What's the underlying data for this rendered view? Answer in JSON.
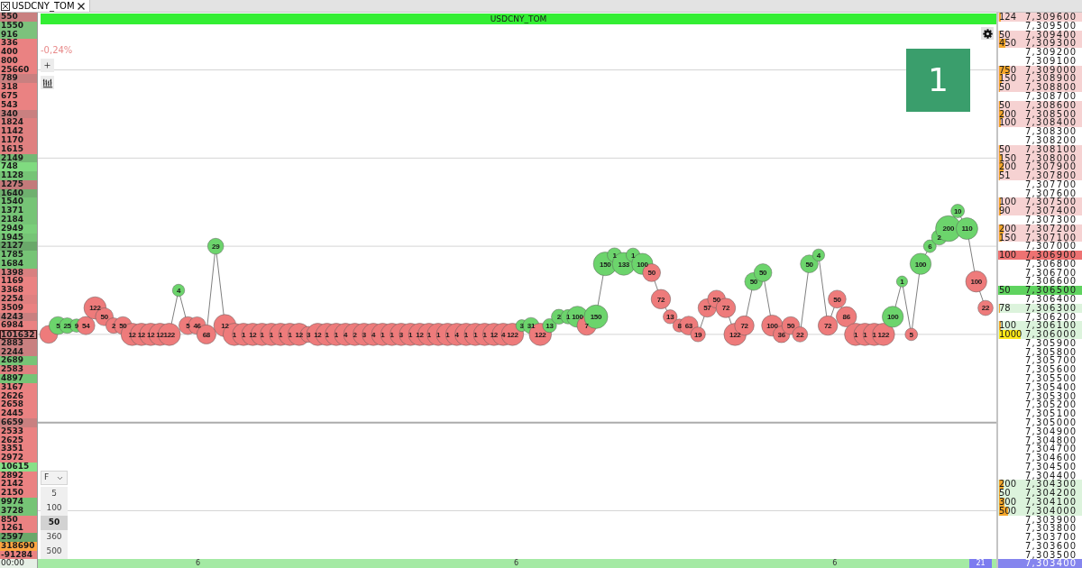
{
  "tab": {
    "title": "USDCNY_TOM"
  },
  "volume_profile": [
    {
      "value": "550",
      "color": "#c98080",
      "highlighted": false
    },
    {
      "value": "1550",
      "color": "#7cc27c",
      "highlighted": false
    },
    {
      "value": "916",
      "color": "#7cc27c",
      "highlighted": false
    },
    {
      "value": "336",
      "color": "#ea8282",
      "highlighted": false
    },
    {
      "value": "400",
      "color": "#ea8282",
      "highlighted": false
    },
    {
      "value": "800",
      "color": "#ea8282",
      "highlighted": false
    },
    {
      "value": "25660",
      "color": "#ea8282",
      "highlighted": false
    },
    {
      "value": "789",
      "color": "#c98080",
      "highlighted": false
    },
    {
      "value": "318",
      "color": "#ea8282",
      "highlighted": false
    },
    {
      "value": "675",
      "color": "#ea8282",
      "highlighted": false
    },
    {
      "value": "543",
      "color": "#ea8282",
      "highlighted": false
    },
    {
      "value": "340",
      "color": "#c98080",
      "highlighted": false
    },
    {
      "value": "1824",
      "color": "#df8080",
      "highlighted": false
    },
    {
      "value": "1142",
      "color": "#df8080",
      "highlighted": false
    },
    {
      "value": "1170",
      "color": "#df8080",
      "highlighted": false
    },
    {
      "value": "1615",
      "color": "#df8080",
      "highlighted": false
    },
    {
      "value": "2149",
      "color": "#74b874",
      "highlighted": false
    },
    {
      "value": "748",
      "color": "#80db80",
      "highlighted": false
    },
    {
      "value": "1128",
      "color": "#76c476",
      "highlighted": false
    },
    {
      "value": "1275",
      "color": "#c37a7a",
      "highlighted": false
    },
    {
      "value": "1640",
      "color": "#6fb06f",
      "highlighted": false
    },
    {
      "value": "1540",
      "color": "#76c476",
      "highlighted": false
    },
    {
      "value": "1371",
      "color": "#76c476",
      "highlighted": false
    },
    {
      "value": "2184",
      "color": "#76c476",
      "highlighted": false
    },
    {
      "value": "2949",
      "color": "#7acf7a",
      "highlighted": false
    },
    {
      "value": "1945",
      "color": "#76c476",
      "highlighted": false
    },
    {
      "value": "2127",
      "color": "#6aa86a",
      "highlighted": false
    },
    {
      "value": "1785",
      "color": "#76c476",
      "highlighted": false
    },
    {
      "value": "1684",
      "color": "#76c476",
      "highlighted": false
    },
    {
      "value": "1398",
      "color": "#d88080",
      "highlighted": false
    },
    {
      "value": "1169",
      "color": "#ea8282",
      "highlighted": false
    },
    {
      "value": "3368",
      "color": "#ea8282",
      "highlighted": false
    },
    {
      "value": "2254",
      "color": "#df8080",
      "highlighted": false
    },
    {
      "value": "3509",
      "color": "#ea8282",
      "highlighted": false
    },
    {
      "value": "4243",
      "color": "#c98080",
      "highlighted": false
    },
    {
      "value": "6984",
      "color": "#ea8282",
      "highlighted": false
    },
    {
      "value": "101632",
      "color": "#d08080",
      "highlighted": true
    },
    {
      "value": "2883",
      "color": "#c98080",
      "highlighted": false
    },
    {
      "value": "2244",
      "color": "#c98080",
      "highlighted": false
    },
    {
      "value": "2689",
      "color": "#76c476",
      "highlighted": false
    },
    {
      "value": "2583",
      "color": "#df8080",
      "highlighted": false
    },
    {
      "value": "4897",
      "color": "#76c476",
      "highlighted": false
    },
    {
      "value": "3167",
      "color": "#ea8282",
      "highlighted": false
    },
    {
      "value": "2626",
      "color": "#ea8282",
      "highlighted": false
    },
    {
      "value": "2658",
      "color": "#ea8282",
      "highlighted": false
    },
    {
      "value": "2445",
      "color": "#ea8282",
      "highlighted": false
    },
    {
      "value": "6659",
      "color": "#c98080",
      "highlighted": false
    },
    {
      "value": "2533",
      "color": "#ea8282",
      "highlighted": false
    },
    {
      "value": "2625",
      "color": "#ea8282",
      "highlighted": false
    },
    {
      "value": "3351",
      "color": "#ea8282",
      "highlighted": false
    },
    {
      "value": "2972",
      "color": "#ea8282",
      "highlighted": false
    },
    {
      "value": "10615",
      "color": "#88e088",
      "highlighted": false
    },
    {
      "value": "2892",
      "color": "#ea8282",
      "highlighted": false
    },
    {
      "value": "2142",
      "color": "#ea8282",
      "highlighted": false
    },
    {
      "value": "2150",
      "color": "#ea8282",
      "highlighted": false
    },
    {
      "value": "9974",
      "color": "#76c476",
      "highlighted": false
    },
    {
      "value": "3728",
      "color": "#76c476",
      "highlighted": false
    },
    {
      "value": "850",
      "color": "#ea8282",
      "highlighted": false
    },
    {
      "value": "1261",
      "color": "#ea8282",
      "highlighted": false
    },
    {
      "value": "2597",
      "color": "#6aa86a",
      "highlighted": false
    },
    {
      "value": "318690",
      "color": "#ffa640",
      "highlighted": false
    },
    {
      "value": "-91284",
      "color": "#ea8282",
      "highlighted": false
    }
  ],
  "chart": {
    "title": "USDCNY_TOM",
    "change": "-0,24%",
    "badge": "1",
    "trades": [
      {
        "color": "#ee7b7b"
      },
      {
        "label": "5",
        "color": "#6cd46c"
      },
      {
        "label": "25",
        "color": "#6cd46c"
      },
      {
        "label": "9",
        "color": "#6cd46c"
      },
      {
        "label": "54",
        "color": "#ee7b7b"
      },
      {
        "label": "122",
        "color": "#ee7b7b"
      },
      {
        "label": "50",
        "color": "#ee7b7b"
      },
      {
        "label": "2",
        "color": "#ee7b7b"
      },
      {
        "label": "50",
        "color": "#ee7b7b"
      },
      {
        "label": "12",
        "color": "#ee7b7b"
      },
      {
        "label": "12",
        "color": "#ee7b7b"
      },
      {
        "label": "12",
        "color": "#ee7b7b"
      },
      {
        "label": "12",
        "color": "#ee7b7b"
      },
      {
        "label": "122",
        "color": "#ee7b7b"
      },
      {
        "label": "4",
        "color": "#6cd46c"
      },
      {
        "label": "5",
        "color": "#ee7b7b"
      },
      {
        "label": "46",
        "color": "#ee7b7b"
      },
      {
        "label": "68",
        "color": "#ee7b7b"
      },
      {
        "label": "29",
        "color": "#6cd46c"
      },
      {
        "label": "12",
        "color": "#ee7b7b"
      },
      {
        "label": "1",
        "color": "#ee7b7b"
      },
      {
        "label": "1",
        "color": "#ee7b7b"
      },
      {
        "label": "12",
        "color": "#ee7b7b"
      },
      {
        "label": "1",
        "color": "#ee7b7b"
      },
      {
        "label": "1",
        "color": "#ee7b7b"
      },
      {
        "label": "1",
        "color": "#ee7b7b"
      },
      {
        "label": "1",
        "color": "#ee7b7b"
      },
      {
        "label": "12",
        "color": "#ee7b7b"
      },
      {
        "label": "3",
        "color": "#ee7b7b"
      },
      {
        "label": "12",
        "color": "#ee7b7b"
      },
      {
        "label": "1",
        "color": "#ee7b7b"
      },
      {
        "label": "1",
        "color": "#ee7b7b"
      },
      {
        "label": "4",
        "color": "#ee7b7b"
      },
      {
        "label": "2",
        "color": "#ee7b7b"
      },
      {
        "label": "3",
        "color": "#ee7b7b"
      },
      {
        "label": "4",
        "color": "#ee7b7b"
      },
      {
        "label": "1",
        "color": "#ee7b7b"
      },
      {
        "label": "1",
        "color": "#ee7b7b"
      },
      {
        "label": "3",
        "color": "#ee7b7b"
      },
      {
        "label": "1",
        "color": "#ee7b7b"
      },
      {
        "label": "12",
        "color": "#ee7b7b"
      },
      {
        "label": "1",
        "color": "#ee7b7b"
      },
      {
        "label": "1",
        "color": "#ee7b7b"
      },
      {
        "label": "1",
        "color": "#ee7b7b"
      },
      {
        "label": "4",
        "color": "#ee7b7b"
      },
      {
        "label": "1",
        "color": "#ee7b7b"
      },
      {
        "label": "1",
        "color": "#ee7b7b"
      },
      {
        "label": "1",
        "color": "#ee7b7b"
      },
      {
        "label": "12",
        "color": "#ee7b7b"
      },
      {
        "label": "4",
        "color": "#ee7b7b"
      },
      {
        "label": "122",
        "color": "#ee7b7b"
      },
      {
        "label": "3",
        "color": "#6cd46c"
      },
      {
        "label": "31",
        "color": "#6cd46c"
      },
      {
        "label": "122",
        "color": "#ee7b7b"
      },
      {
        "label": "13",
        "color": "#6cd46c"
      },
      {
        "label": "2",
        "color": "#6cd46c"
      },
      {
        "label": "1",
        "color": "#6cd46c"
      },
      {
        "label": "100",
        "color": "#6cd46c"
      },
      {
        "label": "7",
        "color": "#ee7b7b"
      },
      {
        "label": "150",
        "color": "#6cd46c"
      },
      {
        "label": "150",
        "color": "#6cd46c"
      },
      {
        "label": "1",
        "color": "#6cd46c"
      },
      {
        "label": "133",
        "color": "#6cd46c"
      },
      {
        "label": "1",
        "color": "#6cd46c"
      },
      {
        "label": "100",
        "color": "#6cd46c"
      },
      {
        "label": "50",
        "color": "#ee7b7b"
      },
      {
        "label": "72",
        "color": "#ee7b7b"
      },
      {
        "label": "13",
        "color": "#ee7b7b"
      },
      {
        "label": "8",
        "color": "#ee7b7b"
      },
      {
        "label": "63",
        "color": "#ee7b7b"
      },
      {
        "label": "19",
        "color": "#ee7b7b"
      },
      {
        "label": "57",
        "color": "#ee7b7b"
      },
      {
        "label": "50",
        "color": "#ee7b7b"
      },
      {
        "label": "72",
        "color": "#ee7b7b"
      },
      {
        "label": "122",
        "color": "#ee7b7b"
      },
      {
        "label": "72",
        "color": "#ee7b7b"
      },
      {
        "label": "50",
        "color": "#6cd46c"
      },
      {
        "label": "50",
        "color": "#6cd46c"
      },
      {
        "label": "100",
        "color": "#ee7b7b"
      },
      {
        "label": "36",
        "color": "#ee7b7b"
      },
      {
        "label": "50",
        "color": "#ee7b7b"
      },
      {
        "label": "22",
        "color": "#ee7b7b"
      },
      {
        "label": "50",
        "color": "#6cd46c"
      },
      {
        "label": "4",
        "color": "#6cd46c"
      },
      {
        "label": "72",
        "color": "#ee7b7b"
      },
      {
        "label": "50",
        "color": "#ee7b7b"
      },
      {
        "label": "86",
        "color": "#ee7b7b"
      },
      {
        "label": "1",
        "color": "#ee7b7b"
      },
      {
        "label": "1",
        "color": "#ee7b7b"
      },
      {
        "label": "1",
        "color": "#ee7b7b"
      },
      {
        "label": "122",
        "color": "#ee7b7b"
      },
      {
        "label": "100",
        "color": "#6cd46c"
      },
      {
        "label": "1",
        "color": "#6cd46c"
      },
      {
        "label": "5",
        "color": "#ee7b7b"
      },
      {
        "label": "100",
        "color": "#6cd46c"
      },
      {
        "label": "6",
        "color": "#6cd46c"
      },
      {
        "label": "2",
        "color": "#6cd46c"
      },
      {
        "label": "200",
        "color": "#6cd46c"
      },
      {
        "label": "10",
        "color": "#6cd46c"
      },
      {
        "label": "110",
        "color": "#6cd46c"
      },
      {
        "label": "100",
        "color": "#ee7b7b"
      },
      {
        "label": "22",
        "color": "#ee7b7b"
      }
    ],
    "filter": {
      "value": "F",
      "options": [
        {
          "label": "5",
          "selected": false
        },
        {
          "label": "100",
          "selected": false
        },
        {
          "label": "50",
          "selected": true
        },
        {
          "label": "360",
          "selected": false
        },
        {
          "label": "500",
          "selected": false
        }
      ]
    }
  },
  "time_axis": {
    "start": "00:00",
    "ticks": [
      "6",
      "6",
      "6"
    ],
    "cursor": "21"
  },
  "order_book": [
    {
      "price": "7,309600",
      "volume": "124",
      "kind": "ask",
      "level": 0.1
    },
    {
      "price": "7,309500",
      "kind": "empty"
    },
    {
      "price": "7,309400",
      "volume": "50",
      "kind": "ask",
      "level": 0.04
    },
    {
      "price": "7,309300",
      "volume": "450",
      "kind": "ask",
      "level": 0.3
    },
    {
      "price": "7,309200",
      "kind": "empty"
    },
    {
      "price": "7,309100",
      "kind": "empty"
    },
    {
      "price": "7,309000",
      "volume": "750",
      "kind": "ask",
      "level": 0.52
    },
    {
      "price": "7,308900",
      "volume": "150",
      "kind": "ask",
      "level": 0.13
    },
    {
      "price": "7,308800",
      "volume": "50",
      "kind": "ask",
      "level": 0.04
    },
    {
      "price": "7,308700",
      "kind": "empty"
    },
    {
      "price": "7,308600",
      "volume": "50",
      "kind": "ask",
      "level": 0.04
    },
    {
      "price": "7,308500",
      "volume": "200",
      "kind": "ask",
      "level": 0.2
    },
    {
      "price": "7,308400",
      "volume": "100",
      "kind": "ask",
      "level": 0.09
    },
    {
      "price": "7,308300",
      "kind": "empty"
    },
    {
      "price": "7,308200",
      "kind": "empty"
    },
    {
      "price": "7,308100",
      "volume": "50",
      "kind": "ask",
      "level": 0.04
    },
    {
      "price": "7,308000",
      "volume": "150",
      "kind": "ask",
      "level": 0.13
    },
    {
      "price": "7,307900",
      "volume": "200",
      "kind": "ask",
      "level": 0.2
    },
    {
      "price": "7,307800",
      "volume": "51",
      "kind": "ask",
      "level": 0.04
    },
    {
      "price": "7,307700",
      "kind": "empty"
    },
    {
      "price": "7,307600",
      "kind": "empty"
    },
    {
      "price": "7,307500",
      "volume": "100",
      "kind": "ask",
      "level": 0.09
    },
    {
      "price": "7,307400",
      "volume": "90",
      "kind": "ask",
      "level": 0.07
    },
    {
      "price": "7,307300",
      "kind": "empty"
    },
    {
      "price": "7,307200",
      "volume": "200",
      "kind": "ask",
      "level": 0.2
    },
    {
      "price": "7,307100",
      "volume": "150",
      "kind": "ask",
      "level": 0.13
    },
    {
      "price": "7,307000",
      "kind": "empty"
    },
    {
      "price": "7,306900",
      "volume": "100",
      "kind": "best_ask"
    },
    {
      "price": "7,306800",
      "kind": "empty"
    },
    {
      "price": "7,306700",
      "kind": "empty"
    },
    {
      "price": "7,306600",
      "kind": "empty"
    },
    {
      "price": "7,306500",
      "volume": "50",
      "kind": "best_bid"
    },
    {
      "price": "7,306400",
      "kind": "empty"
    },
    {
      "price": "7,306300",
      "volume": "78",
      "kind": "bid",
      "level": 0.05
    },
    {
      "price": "7,306200",
      "kind": "empty"
    },
    {
      "price": "7,306100",
      "volume": "100",
      "kind": "bid",
      "level": 0.09
    },
    {
      "price": "7,306000",
      "volume": "1000",
      "kind": "bid",
      "level": 1
    },
    {
      "price": "7,305900",
      "kind": "empty"
    },
    {
      "price": "7,305800",
      "kind": "empty"
    },
    {
      "price": "7,305700",
      "kind": "empty"
    },
    {
      "price": "7,305600",
      "kind": "empty"
    },
    {
      "price": "7,305500",
      "kind": "empty"
    },
    {
      "price": "7,305400",
      "kind": "empty"
    },
    {
      "price": "7,305300",
      "kind": "empty"
    },
    {
      "price": "7,305200",
      "kind": "empty"
    },
    {
      "price": "7,305100",
      "kind": "empty"
    },
    {
      "price": "7,305000",
      "kind": "empty"
    },
    {
      "price": "7,304900",
      "kind": "empty"
    },
    {
      "price": "7,304800",
      "kind": "empty"
    },
    {
      "price": "7,304700",
      "kind": "empty"
    },
    {
      "price": "7,304600",
      "kind": "empty"
    },
    {
      "price": "7,304500",
      "kind": "empty"
    },
    {
      "price": "7,304400",
      "kind": "empty"
    },
    {
      "price": "7,304300",
      "volume": "200",
      "kind": "bid",
      "level": 0.2
    },
    {
      "price": "7,304200",
      "volume": "50",
      "kind": "bid",
      "level": 0.04
    },
    {
      "price": "7,304100",
      "volume": "300",
      "kind": "bid",
      "level": 0.26
    },
    {
      "price": "7,304000",
      "volume": "500",
      "kind": "bid",
      "level": 0.43
    },
    {
      "price": "7,303900",
      "kind": "empty"
    },
    {
      "price": "7,303800",
      "kind": "empty"
    },
    {
      "price": "7,303700",
      "kind": "empty"
    },
    {
      "price": "7,303600",
      "kind": "empty"
    },
    {
      "price": "7,303500",
      "kind": "empty"
    },
    {
      "price": "7,303400",
      "kind": "cursor"
    }
  ]
}
